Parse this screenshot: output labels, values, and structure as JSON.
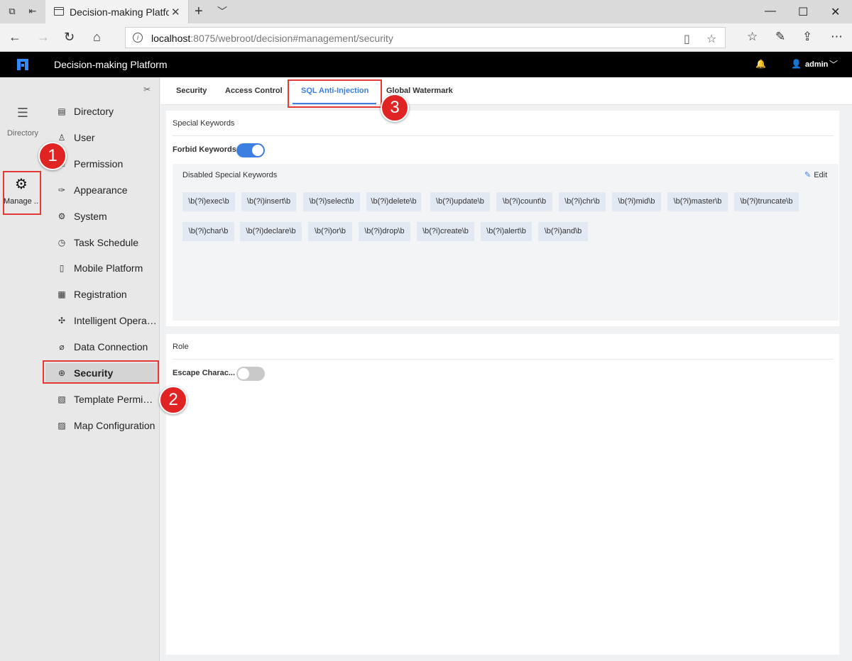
{
  "browser": {
    "tab_title": "Decision-making Platfor",
    "url_host": "localhost",
    "url_rest": ":8075/webroot/decision#management/security"
  },
  "app": {
    "title": "Decision-making Platform",
    "user": "admin"
  },
  "rail": {
    "directory_label": "Directory",
    "manage_label": "Manage ..."
  },
  "menu": {
    "items": [
      {
        "label": "Directory",
        "icon": "directory-icon"
      },
      {
        "label": "User",
        "icon": "user-icon"
      },
      {
        "label": "Permission",
        "icon": "permission-icon"
      },
      {
        "label": "Appearance",
        "icon": "appearance-icon"
      },
      {
        "label": "System",
        "icon": "gear-icon"
      },
      {
        "label": "Task Schedule",
        "icon": "timer-icon"
      },
      {
        "label": "Mobile Platform",
        "icon": "mobile-icon"
      },
      {
        "label": "Registration",
        "icon": "registration-icon"
      },
      {
        "label": "Intelligent Operations",
        "icon": "network-icon"
      },
      {
        "label": "Data Connection",
        "icon": "paperclip-icon"
      },
      {
        "label": "Security",
        "icon": "shield-icon"
      },
      {
        "label": "Template Permission",
        "icon": "template-icon"
      },
      {
        "label": "Map Configuration",
        "icon": "map-icon"
      }
    ]
  },
  "subtabs": [
    {
      "label": "Security"
    },
    {
      "label": "Access Control"
    },
    {
      "label": "SQL Anti-Injection"
    },
    {
      "label": "Global Watermark"
    }
  ],
  "special_keywords": {
    "title": "Special Keywords",
    "forbid_label": "Forbid Keywords",
    "forbid_on": true,
    "box_title": "Disabled Special Keywords",
    "edit_label": "Edit",
    "row1": [
      "\\b(?i)exec\\b",
      "\\b(?i)insert\\b",
      "\\b(?i)select\\b",
      "\\b(?i)delete\\b",
      "\\b(?i)update\\b",
      "\\b(?i)count\\b",
      "\\b(?i)chr\\b",
      "\\b(?i)mid\\b",
      "\\b(?i)master\\b",
      "\\b(?i)truncate\\b"
    ],
    "row2": [
      "\\b(?i)char\\b",
      "\\b(?i)declare\\b",
      "\\b(?i)or\\b",
      "\\b(?i)drop\\b",
      "\\b(?i)create\\b",
      "\\b(?i)alert\\b",
      "\\b(?i)and\\b"
    ]
  },
  "role": {
    "title": "Role",
    "escape_label": "Escape Charac...",
    "escape_on": false
  },
  "annotations": [
    "1",
    "2",
    "3"
  ],
  "colors": {
    "accent": "#3d7fe0",
    "annotation_red": "#e02424",
    "header_bg": "#000000"
  }
}
